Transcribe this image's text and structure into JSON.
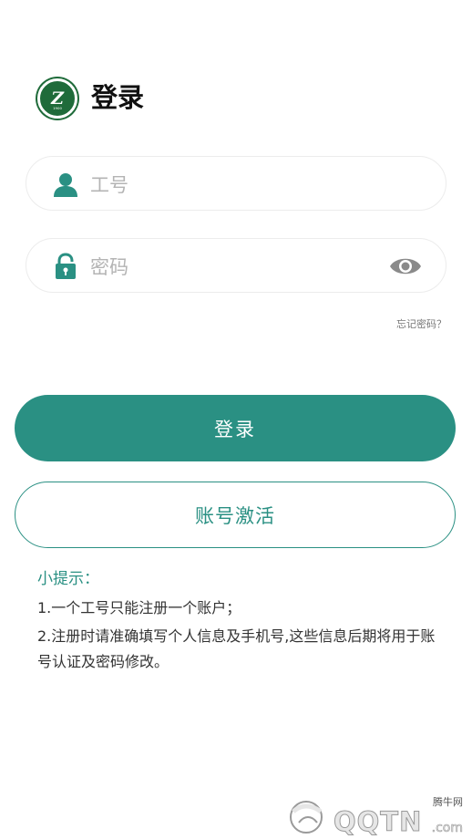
{
  "header": {
    "title": "登录",
    "logo_icon": "company-logo",
    "logo_year": "1900"
  },
  "form": {
    "employee_id": {
      "placeholder": "工号",
      "value": "",
      "icon": "user-icon"
    },
    "password": {
      "placeholder": "密码",
      "value": "",
      "icon": "lock-icon",
      "toggle_icon": "eye-icon"
    },
    "forgot_label": "忘记密码？"
  },
  "actions": {
    "login_label": "登录",
    "activate_label": "账号激活"
  },
  "tips": {
    "title": "小提示：",
    "items": [
      "1.一个工号只能注册一个账户；",
      "2.注册时请准确填写个人信息及手机号,这些信息后期将用于账号认证及密码修改。"
    ]
  },
  "watermark": {
    "top": "腾牛网",
    "text": "QQTN",
    "suffix": ".com"
  },
  "colors": {
    "accent": "#2a9083",
    "logo": "#1f6b3a"
  }
}
